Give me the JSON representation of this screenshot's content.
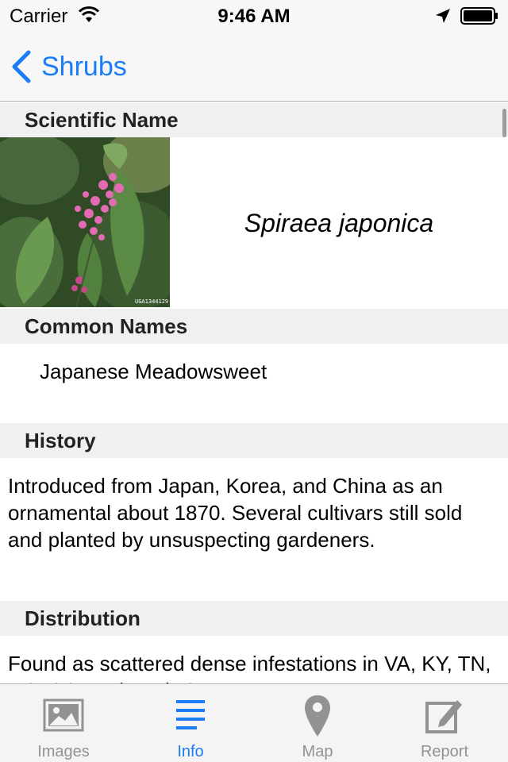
{
  "status_bar": {
    "carrier": "Carrier",
    "time": "9:46 AM"
  },
  "nav": {
    "back_label": "Shrubs"
  },
  "sections": {
    "scientific": {
      "header": "Scientific Name",
      "name": "Spiraea japonica",
      "image_caption": "UGA1344129"
    },
    "common": {
      "header": "Common Names",
      "text": "Japanese Meadowsweet"
    },
    "history": {
      "header": "History",
      "text": "Introduced from Japan, Korea, and China as an ornamental about 1870. Several cultivars still sold and planted by unsuspecting gardeners."
    },
    "distribution": {
      "header": "Distribution",
      "text": "Found as scattered dense infestations in VA, KY, TN, NC, SC, and north GA."
    }
  },
  "tabs": [
    {
      "label": "Images",
      "icon": "image-icon",
      "active": false
    },
    {
      "label": "Info",
      "icon": "list-icon",
      "active": true
    },
    {
      "label": "Map",
      "icon": "map-pin-icon",
      "active": false
    },
    {
      "label": "Report",
      "icon": "compose-icon",
      "active": false
    }
  ],
  "colors": {
    "accent": "#1a7cf7",
    "inactive": "#929292",
    "section_bg": "#f0f0f0"
  }
}
